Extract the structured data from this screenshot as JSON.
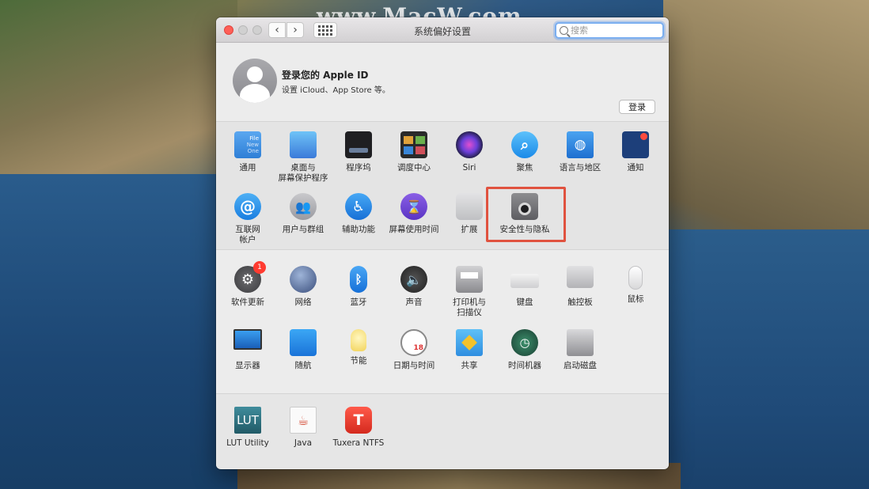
{
  "watermark": "www.MacW.com",
  "window": {
    "title": "系统偏好设置",
    "search_placeholder": "搜索"
  },
  "account": {
    "title": "登录您的 Apple ID",
    "subtitle": "设置 iCloud、App Store 等。",
    "login_label": "登录"
  },
  "panes_row1": [
    {
      "label": "通用",
      "icon": "general-icon"
    },
    {
      "label": "桌面与\n屏幕保护程序",
      "icon": "desktop-icon"
    },
    {
      "label": "程序坞",
      "icon": "dock-icon"
    },
    {
      "label": "调度中心",
      "icon": "mission-control-icon"
    },
    {
      "label": "Siri",
      "icon": "siri-icon"
    },
    {
      "label": "聚焦",
      "icon": "spotlight-icon"
    },
    {
      "label": "语言与地区",
      "icon": "language-icon"
    },
    {
      "label": "通知",
      "icon": "notifications-icon"
    }
  ],
  "panes_row2": [
    {
      "label": "互联网\n帐户",
      "icon": "internet-accounts-icon"
    },
    {
      "label": "用户与群组",
      "icon": "users-icon"
    },
    {
      "label": "辅助功能",
      "icon": "accessibility-icon"
    },
    {
      "label": "屏幕使用时间",
      "icon": "screen-time-icon"
    },
    {
      "label": "扩展",
      "icon": "extensions-icon"
    },
    {
      "label": "安全性与隐私",
      "icon": "security-icon"
    }
  ],
  "panes_row3": [
    {
      "label": "软件更新",
      "icon": "software-update-icon",
      "badge": "1"
    },
    {
      "label": "网络",
      "icon": "network-icon"
    },
    {
      "label": "蓝牙",
      "icon": "bluetooth-icon"
    },
    {
      "label": "声音",
      "icon": "sound-icon"
    },
    {
      "label": "打印机与\n扫描仪",
      "icon": "printer-icon"
    },
    {
      "label": "键盘",
      "icon": "keyboard-icon"
    },
    {
      "label": "触控板",
      "icon": "trackpad-icon"
    },
    {
      "label": "鼠标",
      "icon": "mouse-icon"
    }
  ],
  "panes_row4": [
    {
      "label": "显示器",
      "icon": "display-icon"
    },
    {
      "label": "随航",
      "icon": "sidecar-icon"
    },
    {
      "label": "节能",
      "icon": "energy-icon"
    },
    {
      "label": "日期与时间",
      "icon": "date-time-icon",
      "day": "18"
    },
    {
      "label": "共享",
      "icon": "sharing-icon"
    },
    {
      "label": "时间机器",
      "icon": "time-machine-icon"
    },
    {
      "label": "启动磁盘",
      "icon": "startup-disk-icon"
    }
  ],
  "panes_row5": [
    {
      "label": "LUT Utility",
      "icon": "lut-icon",
      "icon_text": "LUT"
    },
    {
      "label": "Java",
      "icon": "java-icon"
    },
    {
      "label": "Tuxera NTFS",
      "icon": "tuxera-icon",
      "icon_text": "T"
    }
  ],
  "general_icon_text": [
    "File",
    "New",
    "One"
  ]
}
